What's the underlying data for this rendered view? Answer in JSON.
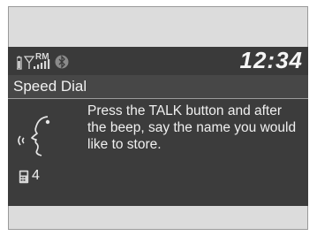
{
  "header": {
    "roaming_label": "RM",
    "clock": "12:34"
  },
  "screen": {
    "title": "Speed Dial"
  },
  "content": {
    "instruction": "Press the TALK button and after the beep, say the name you would like to store.",
    "entry_count": "4"
  },
  "icons": {
    "battery": "battery-icon",
    "signal": "signal-strength-icon",
    "bluetooth": "bluetooth-icon",
    "voice": "voice-talk-icon",
    "phone": "phone-icon"
  },
  "colors": {
    "screen_background": "#3c3c3c",
    "text": "#f2f2f2",
    "frame": "#dcdcdc"
  }
}
